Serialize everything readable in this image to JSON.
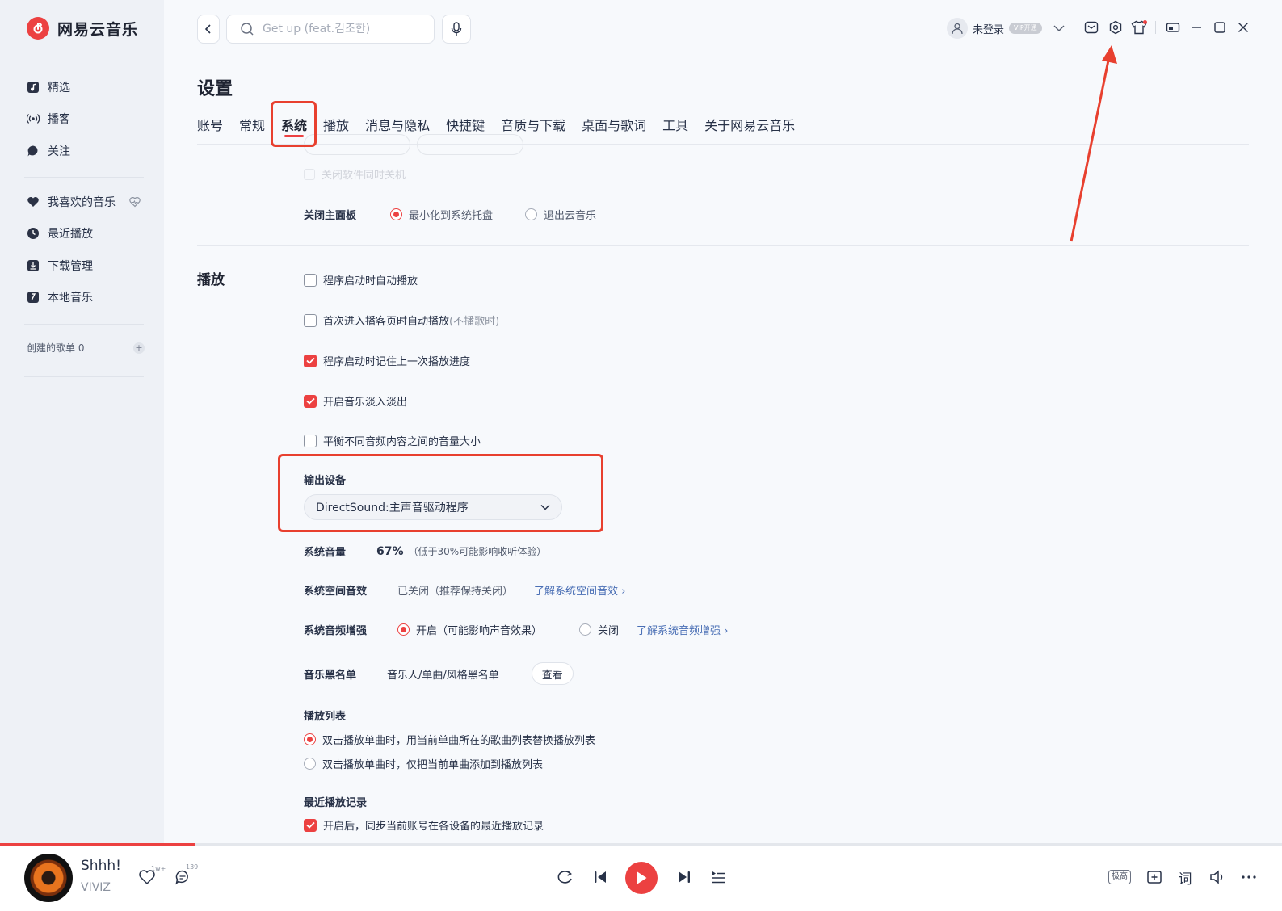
{
  "app": {
    "name": "网易云音乐"
  },
  "sidebar": {
    "items": [
      {
        "label": "精选",
        "icon": "music-note-icon"
      },
      {
        "label": "播客",
        "icon": "broadcast-icon"
      },
      {
        "label": "关注",
        "icon": "chat-bubble-icon"
      },
      {
        "label": "我喜欢的音乐",
        "icon": "heart-icon"
      },
      {
        "label": "最近播放",
        "icon": "clock-icon"
      },
      {
        "label": "下载管理",
        "icon": "download-icon"
      },
      {
        "label": "本地音乐",
        "icon": "local-music-icon"
      }
    ],
    "created_playlists": "创建的歌单 0"
  },
  "topbar": {
    "search_placeholder": "Get up (feat.김조한)",
    "user_label": "未登录",
    "vip_label": "VIP开通"
  },
  "page": {
    "title": "设置",
    "tabs": [
      "账号",
      "常规",
      "系统",
      "播放",
      "消息与隐私",
      "快捷键",
      "音质与下载",
      "桌面与歌词",
      "工具",
      "关于网易云音乐"
    ],
    "active_tab": "系统"
  },
  "system": {
    "ghost_text": "关闭软件同时关机",
    "close_panel": {
      "label": "关闭主面板",
      "option_minimize": "最小化到系统托盘",
      "option_exit": "退出云音乐",
      "selected": "最小化到系统托盘"
    }
  },
  "playback": {
    "section_title": "播放",
    "checkboxes": [
      {
        "label": "程序启动时自动播放",
        "note": "",
        "checked": false
      },
      {
        "label": "首次进入播客页时自动播放",
        "note": "(不播歌时)",
        "checked": false
      },
      {
        "label": "程序启动时记住上一次播放进度",
        "note": "",
        "checked": true
      },
      {
        "label": "开启音乐淡入淡出",
        "note": "",
        "checked": true
      },
      {
        "label": "平衡不同音频内容之间的音量大小",
        "note": "",
        "checked": false
      }
    ],
    "output_device": {
      "label": "输出设备",
      "selected": "DirectSound:主声音驱动程序"
    },
    "system_volume": {
      "label": "系统音量",
      "value": "67%",
      "note": "（低于30%可能影响收听体验）"
    },
    "spatial_audio": {
      "label": "系统空间音效",
      "status": "已关闭（推荐保持关闭）",
      "link": "了解系统空间音效"
    },
    "audio_enhance": {
      "label": "系统音频增强",
      "option_on": "开启（可能影响声音效果）",
      "option_off": "关闭",
      "selected": "开启",
      "link": "了解系统音频增强"
    },
    "blacklist": {
      "label": "音乐黑名单",
      "text": "音乐人/单曲/风格黑名单",
      "button": "查看"
    },
    "playlist": {
      "label": "播放列表",
      "option_replace": "双击播放单曲时，用当前单曲所在的歌曲列表替换播放列表",
      "option_add": "双击播放单曲时，仅把当前单曲添加到播放列表",
      "selected": "replace"
    },
    "recent": {
      "label": "最近播放记录",
      "checkbox": "开启后，同步当前账号在各设备的最近播放记录",
      "checked": true
    }
  },
  "player": {
    "song_title": "Shhh!",
    "artist": "VIVIZ",
    "like_count": "1w+",
    "comment_count": "139",
    "quality": "极高",
    "lyrics_label": "词",
    "progress": 0.152
  },
  "colors": {
    "accent": "#ec4141",
    "annotation": "#e8402f",
    "link": "#4a6fb5"
  }
}
